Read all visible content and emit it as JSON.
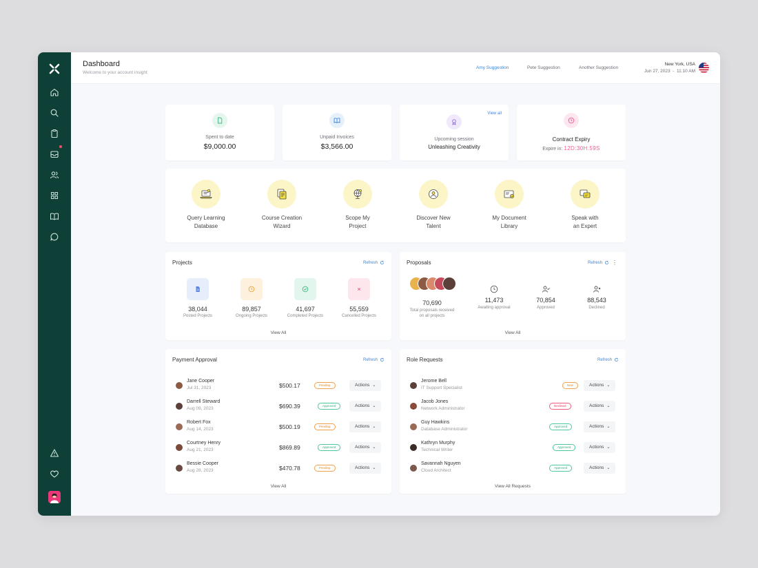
{
  "header": {
    "title": "Dashboard",
    "subtitle": "Welcome to your account insight",
    "suggestions": [
      "Amy Suggestion",
      "Pete Suggestion",
      "Another Suggestion"
    ],
    "location": "New York, USA",
    "date": "Jun 27, 2023",
    "time": "11:10 AM"
  },
  "sidebar": {
    "items": [
      "home-icon",
      "search-icon",
      "clipboard-icon",
      "inbox-icon",
      "users-icon",
      "grid-icon",
      "book-icon",
      "chat-icon"
    ],
    "bottom": [
      "alert-icon",
      "heart-icon"
    ]
  },
  "stats": {
    "spent_label": "Spent to date",
    "spent_value": "$9,000.00",
    "unpaid_label": "Unpaid Invoices",
    "unpaid_value": "$3,566.00",
    "session_label": "Upcoming session",
    "session_value": "Unleashing Creativity",
    "session_link": "View all",
    "contract_label": "Contract Expiry",
    "contract_expiry_label": "Expire in:",
    "contract_timer": "12D:30H:59S"
  },
  "quick_actions": [
    {
      "line1": "Query Learning",
      "line2": "Database"
    },
    {
      "line1": "Course Creation",
      "line2": "Wizard"
    },
    {
      "line1": "Scope My",
      "line2": "Project"
    },
    {
      "line1": "Discover New",
      "line2": "Talent"
    },
    {
      "line1": "My Document",
      "line2": "Library"
    },
    {
      "line1": "Speak with",
      "line2": "an Expert"
    }
  ],
  "projects": {
    "title": "Projects",
    "refresh": "Refresh",
    "items": [
      {
        "value": "38,044",
        "label": "Posted Projects"
      },
      {
        "value": "89,857",
        "label": "Ongoing Projects"
      },
      {
        "value": "41,697",
        "label": "Completed Projects"
      },
      {
        "value": "55,559",
        "label": "Cancelled Projects"
      }
    ],
    "footer": "View All"
  },
  "proposals": {
    "title": "Proposals",
    "refresh": "Refresh",
    "total_value": "70,690",
    "total_label1": "Total proposals received",
    "total_label2": "on all projects",
    "items": [
      {
        "value": "11,473",
        "label": "Awaiting approval"
      },
      {
        "value": "70,854",
        "label": "Approved"
      },
      {
        "value": "88,543",
        "label": "Declined"
      }
    ],
    "footer": "View All"
  },
  "payment_approval": {
    "title": "Payment Approval",
    "refresh": "Refresh",
    "rows": [
      {
        "name": "Jane Cooper",
        "date": "Jul 31, 2023",
        "amount": "$500.17",
        "status": "Pending",
        "action": "Actions"
      },
      {
        "name": "Darrell Steward",
        "date": "Aug 09, 2023",
        "amount": "$690.39",
        "status": "Approved",
        "action": "Actions"
      },
      {
        "name": "Robert Fox",
        "date": "Aug 14, 2023",
        "amount": "$500.19",
        "status": "Pending",
        "action": "Actions"
      },
      {
        "name": "Courtney Henry",
        "date": "Aug 21, 2023",
        "amount": "$869.89",
        "status": "Approved",
        "action": "Actions"
      },
      {
        "name": "Bessie Cooper",
        "date": "Aug 28, 2023",
        "amount": "$470.78",
        "status": "Pending",
        "action": "Actions"
      }
    ],
    "footer": "View All"
  },
  "role_requests": {
    "title": "Role Requests",
    "refresh": "Refresh",
    "rows": [
      {
        "name": "Jerome Bell",
        "role": "IT Support Specialist",
        "status": "New",
        "action": "Actions"
      },
      {
        "name": "Jacob Jones",
        "role": "Network Administrator",
        "status": "Declined",
        "action": "Actions"
      },
      {
        "name": "Guy Hawkins",
        "role": "Database Administrator",
        "status": "Approved",
        "action": "Actions"
      },
      {
        "name": "Kathryn Murphy",
        "role": "Technical Writer",
        "status": "Approved",
        "action": "Actions"
      },
      {
        "name": "Savannah Nguyen",
        "role": "Cloud Architect",
        "status": "Approved",
        "action": "Actions"
      }
    ],
    "footer": "View All Requests"
  },
  "colors": {
    "sidebar": "#0e4038",
    "accent_link": "#3d86d9",
    "pending": "#e08a2b",
    "approved": "#32ad7c",
    "declined": "#e0405f",
    "timer": "#f06292"
  }
}
